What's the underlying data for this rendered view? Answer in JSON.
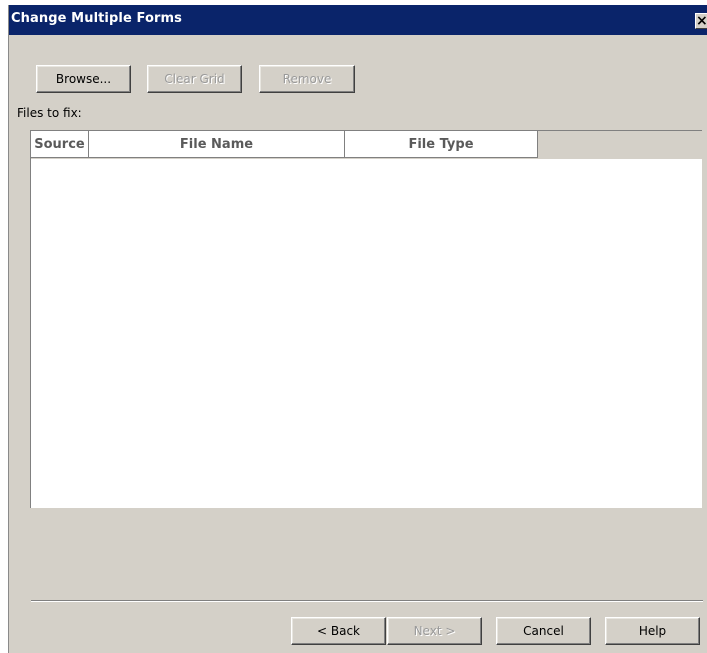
{
  "window": {
    "title": "Change Multiple Forms",
    "close_label": "×"
  },
  "toolbar": {
    "browse_label": "Browse...",
    "clear_grid_label": "Clear Grid",
    "remove_label": "Remove"
  },
  "files_label": "Files to fix:",
  "grid": {
    "columns": [
      "Source",
      "File Name",
      "File Type"
    ],
    "rows": []
  },
  "footer": {
    "back_label": "< Back",
    "next_label": "Next >",
    "cancel_label": "Cancel",
    "help_label": "Help"
  },
  "colors": {
    "title_bar": "#0a246a",
    "dialog_bg": "#d4d0c8",
    "disabled_text": "#9a9a9a"
  }
}
